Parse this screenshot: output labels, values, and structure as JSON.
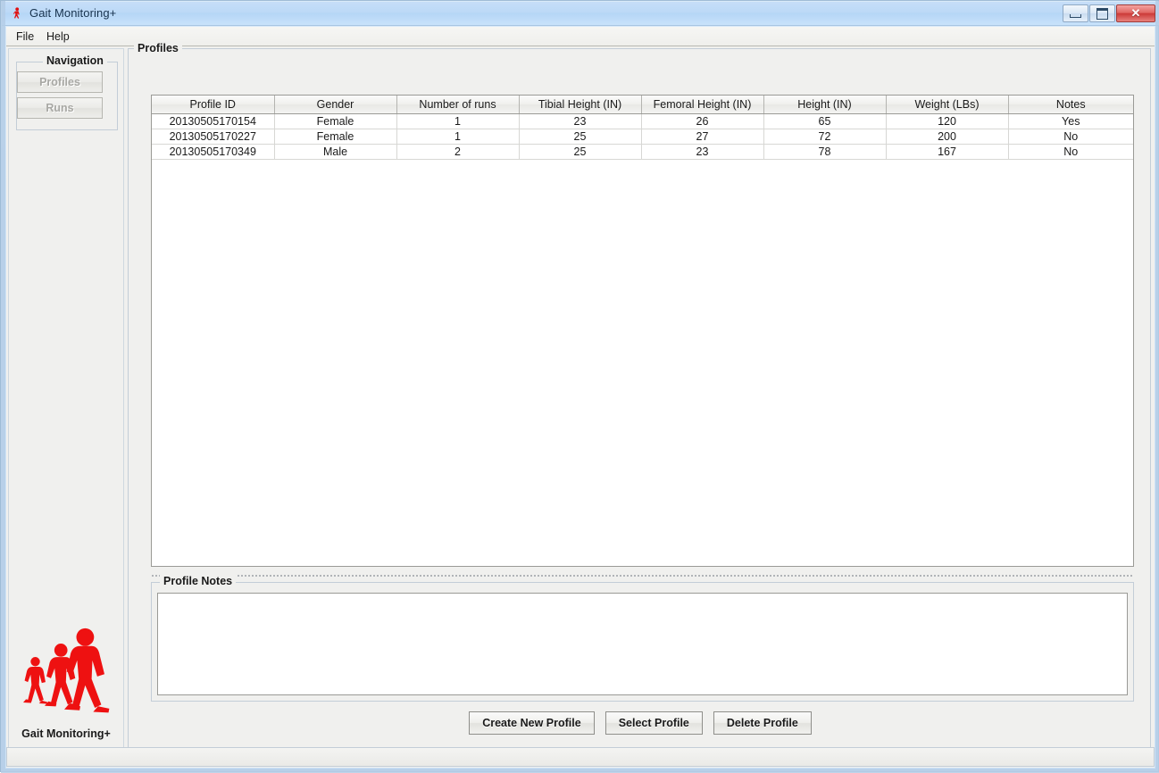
{
  "window": {
    "title": "Gait Monitoring+",
    "app_icon": "walking-person-icon",
    "minimize_label": "",
    "maximize_label": "",
    "close_label": "✕"
  },
  "menubar": {
    "items": [
      {
        "label": "File"
      },
      {
        "label": "Help"
      }
    ]
  },
  "sidebar": {
    "group_title": "Navigation",
    "buttons": [
      {
        "label": "Profiles",
        "enabled": false
      },
      {
        "label": "Runs",
        "enabled": false
      }
    ],
    "logo_caption": "Gait Monitoring+",
    "logo_color": "#ee1111"
  },
  "main": {
    "group_title": "Profiles",
    "table": {
      "columns": [
        "Profile ID",
        "Gender",
        "Number of runs",
        "Tibial Height (IN)",
        "Femoral Height (IN)",
        "Height (IN)",
        "Weight (LBs)",
        "Notes"
      ],
      "rows": [
        [
          "20130505170154",
          "Female",
          "1",
          "23",
          "26",
          "65",
          "120",
          "Yes"
        ],
        [
          "20130505170227",
          "Female",
          "1",
          "25",
          "27",
          "72",
          "200",
          "No"
        ],
        [
          "20130505170349",
          "Male",
          "2",
          "25",
          "23",
          "78",
          "167",
          "No"
        ]
      ]
    },
    "notes": {
      "group_title": "Profile Notes",
      "value": ""
    },
    "buttons": [
      {
        "label": "Create New Profile"
      },
      {
        "label": "Select Profile"
      },
      {
        "label": "Delete Profile"
      }
    ]
  },
  "statusbar": {
    "text": ""
  }
}
